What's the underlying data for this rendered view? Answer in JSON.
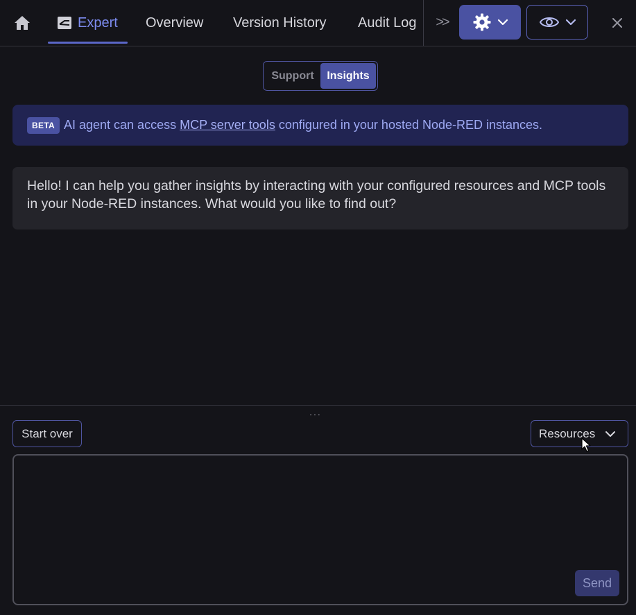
{
  "nav": {
    "tabs": [
      {
        "label": "Expert",
        "icon": "expert-logo-icon",
        "active": true
      },
      {
        "label": "Overview"
      },
      {
        "label": "Version History"
      },
      {
        "label": "Audit Log"
      }
    ],
    "overflow_label": ">>"
  },
  "mode_toggle": {
    "options": [
      "Support",
      "Insights"
    ],
    "selected": "Insights"
  },
  "banner": {
    "badge": "BETA",
    "text_before": "AI agent can access",
    "link_text": "MCP server tools",
    "text_after": "configured in your hosted Node-RED instances."
  },
  "message": {
    "text": "Hello! I can help you gather insights by interacting with your configured resources and MCP tools in your Node-RED instances. What would you like to find out?"
  },
  "controls": {
    "start_over": "Start over",
    "resources": "Resources",
    "send": "Send",
    "grip": "..."
  },
  "prompt": {
    "value": "",
    "placeholder": ""
  },
  "colors": {
    "background": "#141419",
    "accent": "#4a52a2",
    "active_tab": "#7d8cf0",
    "banner_bg": "#212452"
  }
}
